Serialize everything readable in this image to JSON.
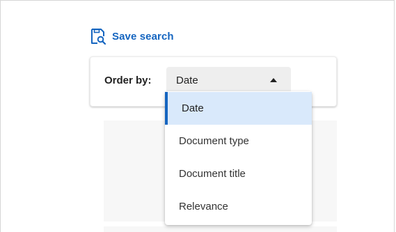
{
  "save_search": {
    "label": "Save search",
    "icon": "save-search-icon"
  },
  "order_by": {
    "label": "Order by:",
    "selected": "Date",
    "options": [
      {
        "label": "Date",
        "selected": true
      },
      {
        "label": "Document type",
        "selected": false
      },
      {
        "label": "Document title",
        "selected": false
      },
      {
        "label": "Relevance",
        "selected": false
      }
    ]
  },
  "colors": {
    "accent": "#1565c0",
    "selected_bg": "#d9e9fb",
    "select_bg": "#eeeeee"
  }
}
